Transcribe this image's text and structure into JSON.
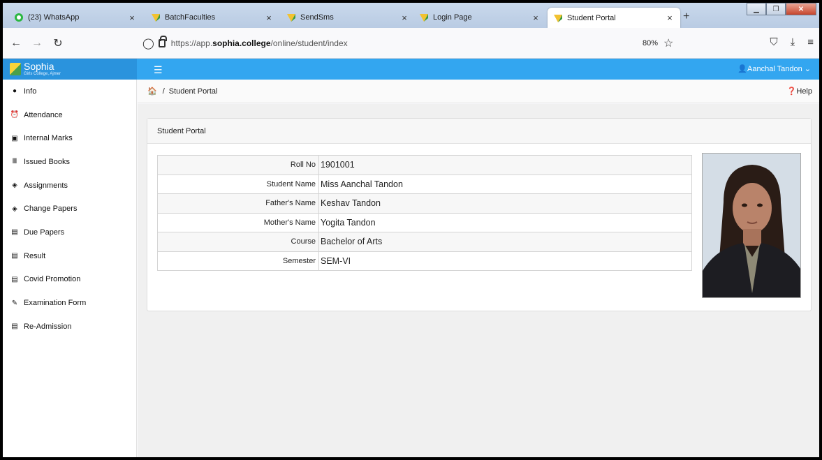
{
  "browser": {
    "tabs": [
      {
        "title": "(23) WhatsApp",
        "close": "×"
      },
      {
        "title": "BatchFaculties",
        "close": "×"
      },
      {
        "title": "SendSms",
        "close": "×"
      },
      {
        "title": "Login Page",
        "close": "×"
      },
      {
        "title": "Student Portal",
        "close": "×"
      }
    ],
    "new_tab": "+",
    "url_prefix": "https://app.",
    "url_domain": "sophia.college",
    "url_path": "/online/student/index",
    "zoom": "80%"
  },
  "app": {
    "brand_name": "Sophia",
    "brand_sub": "Girls College, Ajmer",
    "user_name": "Aanchal Tandon",
    "accent": "#33a6f0"
  },
  "sidebar": {
    "items": [
      {
        "label": "Info",
        "icon": "info-circle-icon"
      },
      {
        "label": "Attendance",
        "icon": "alarm-clock-icon"
      },
      {
        "label": "Internal Marks",
        "icon": "marks-icon"
      },
      {
        "label": "Issued Books",
        "icon": "books-icon"
      },
      {
        "label": "Assignments",
        "icon": "layers-icon"
      },
      {
        "label": "Change Papers",
        "icon": "layers-icon"
      },
      {
        "label": "Due Papers",
        "icon": "clipboard-icon"
      },
      {
        "label": "Result",
        "icon": "clipboard-icon"
      },
      {
        "label": "Covid Promotion",
        "icon": "clipboard-icon"
      },
      {
        "label": "Examination Form",
        "icon": "pencil-icon"
      },
      {
        "label": "Re-Admission",
        "icon": "clipboard-icon"
      }
    ]
  },
  "breadcrumb": {
    "separator": "/",
    "current": "Student Portal",
    "help": "Help"
  },
  "panel": {
    "title": "Student Portal",
    "rows": [
      {
        "label": "Roll No",
        "value": "1901001"
      },
      {
        "label": "Student Name",
        "value": "Miss Aanchal Tandon"
      },
      {
        "label": "Father's Name",
        "value": "Keshav Tandon"
      },
      {
        "label": "Mother's Name",
        "value": "Yogita Tandon"
      },
      {
        "label": "Course",
        "value": "Bachelor of Arts"
      },
      {
        "label": "Semester",
        "value": "SEM-VI"
      }
    ]
  }
}
